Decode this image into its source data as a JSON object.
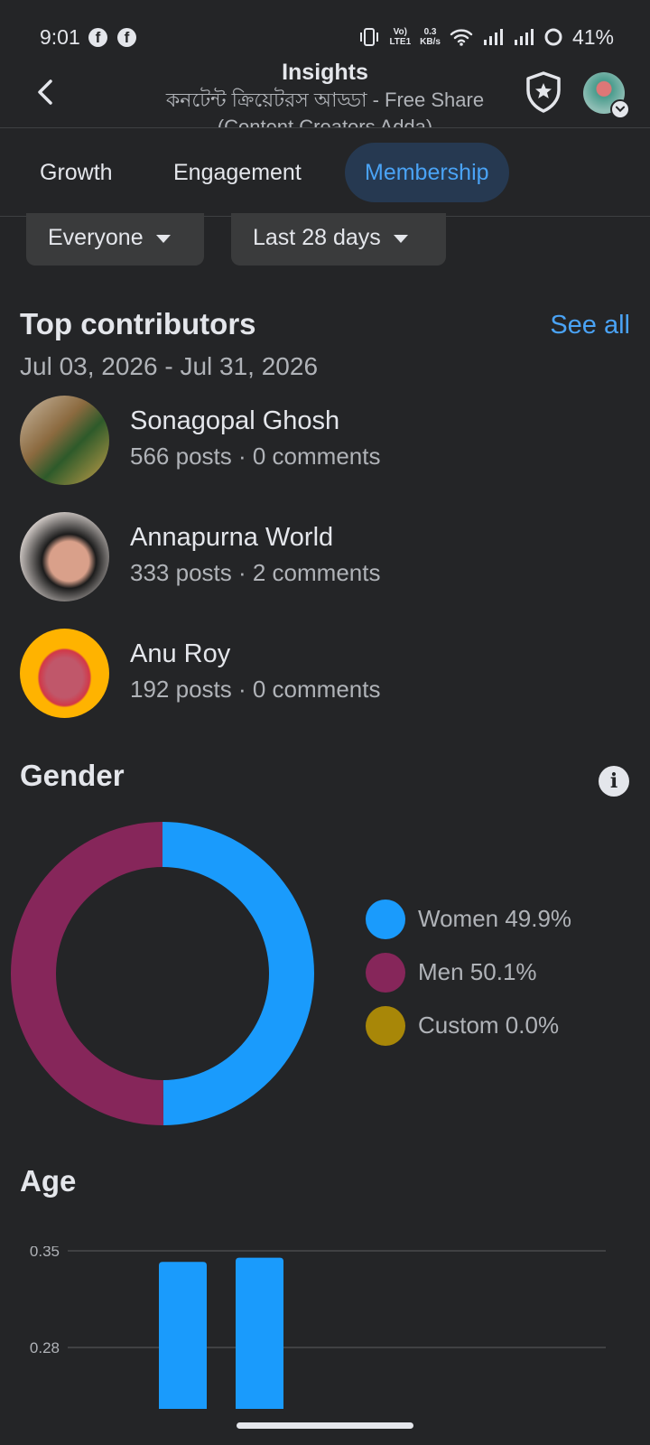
{
  "status_bar": {
    "time": "9:01",
    "fb_icon_1": "f",
    "fb_icon_2": "f",
    "volte": "Vo)",
    "lte": "LTE1",
    "speed_value": "0.3",
    "speed_unit": "KB/s",
    "battery": "41%"
  },
  "header": {
    "title": "Insights",
    "subtitle": "কনটেন্ট ক্রিয়েটরস আড্ডা - Free Share (Content Creators Adda)"
  },
  "tabs": [
    {
      "label": "Growth"
    },
    {
      "label": "Engagement"
    },
    {
      "label": "Membership",
      "active": true
    }
  ],
  "filters": {
    "audience": "Everyone",
    "period": "Last 28 days"
  },
  "top_contributors": {
    "title": "Top contributors",
    "see_all": "See all",
    "date_range": "Jul 03, 2026 - Jul 31, 2026",
    "items": [
      {
        "name": "Sonagopal Ghosh",
        "stats": "566 posts · 0 comments"
      },
      {
        "name": "Annapurna World",
        "stats": "333 posts · 2 comments"
      },
      {
        "name": "Anu Roy",
        "stats": "192 posts · 0 comments"
      }
    ]
  },
  "gender": {
    "title": "Gender",
    "info_icon": "i",
    "legend": [
      {
        "label": "Women 49.9%",
        "color": "#1a9bfc"
      },
      {
        "label": "Men 50.1%",
        "color": "#86265a"
      },
      {
        "label": "Custom 0.0%",
        "color": "#a88708"
      }
    ]
  },
  "chart_data": [
    {
      "type": "pie",
      "categories": [
        "Women",
        "Men",
        "Custom"
      ],
      "values": [
        49.9,
        50.1,
        0.0
      ],
      "colors": [
        "#1a9bfc",
        "#86265a",
        "#a88708"
      ],
      "donut": true,
      "legend_placement": "right"
    },
    {
      "type": "bar",
      "title": "Age",
      "categories": [
        "",
        ""
      ],
      "values": [
        0.342,
        0.345
      ],
      "ytick_labels": [
        "0.35",
        "0.28"
      ],
      "ylim": [
        0.28,
        0.35
      ],
      "grid": true,
      "color": "#1a9bfc"
    }
  ],
  "age": {
    "title": "Age"
  }
}
